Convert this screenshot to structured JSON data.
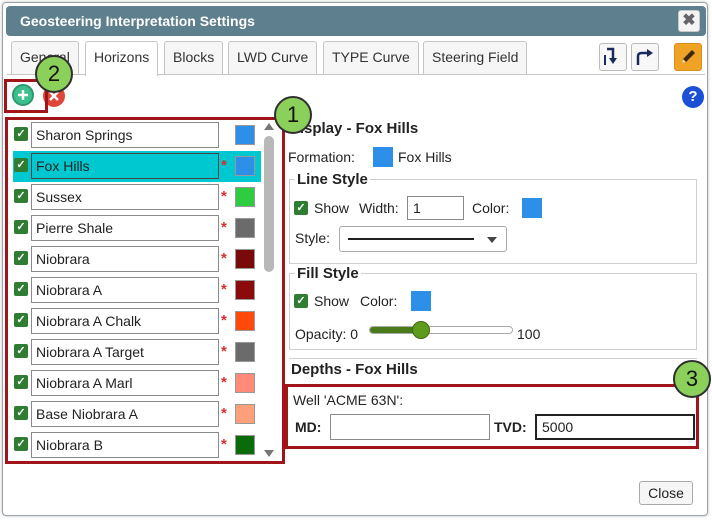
{
  "window": {
    "title": "Geosteering Interpretation Settings",
    "close_symbol": "✖"
  },
  "tabs": [
    {
      "label": "General"
    },
    {
      "label": "Horizons"
    },
    {
      "label": "Blocks"
    },
    {
      "label": "LWD Curve"
    },
    {
      "label": "TYPE Curve"
    },
    {
      "label": "Steering Field"
    }
  ],
  "active_tab": "Horizons",
  "callouts": {
    "one": "1",
    "two": "2",
    "three": "3"
  },
  "help_symbol": "?",
  "horizons": [
    {
      "name": "Sharon Springs",
      "required": false,
      "color": "#2e8fe8"
    },
    {
      "name": "Fox Hills",
      "required": true,
      "color": "#2e8fe8"
    },
    {
      "name": "Sussex",
      "required": true,
      "color": "#2ecc40"
    },
    {
      "name": "Pierre Shale",
      "required": true,
      "color": "#6b6b6b"
    },
    {
      "name": "Niobrara",
      "required": true,
      "color": "#7a0a0a"
    },
    {
      "name": "Niobrara A",
      "required": true,
      "color": "#8b0a0a"
    },
    {
      "name": "Niobrara A Chalk",
      "required": true,
      "color": "#ff4a0a"
    },
    {
      "name": "Niobrara A Target",
      "required": true,
      "color": "#6b6b6b"
    },
    {
      "name": "Niobrara A Marl",
      "required": true,
      "color": "#ff8a78"
    },
    {
      "name": "Base Niobrara A",
      "required": true,
      "color": "#ffa07a"
    },
    {
      "name": "Niobrara B",
      "required": true,
      "color": "#0a6b0a"
    }
  ],
  "required_marker": "*",
  "display": {
    "title": "Display - Fox Hills",
    "formation_label": "Formation:",
    "formation_value": "Fox Hills",
    "formation_color": "#2e8fe8",
    "line_style": {
      "title": "Line Style",
      "show_label": "Show",
      "width_label": "Width:",
      "width_value": "1",
      "color_label": "Color:",
      "color": "#2e8fe8",
      "style_label": "Style:"
    },
    "fill_style": {
      "title": "Fill Style",
      "show_label": "Show",
      "color_label": "Color:",
      "color": "#2e8fe8",
      "opacity_label": "Opacity: 0",
      "opacity_max_label": "100",
      "opacity_fraction": 0.36
    }
  },
  "depths": {
    "title": "Depths - Fox Hills",
    "well_label": "Well 'ACME 63N':",
    "md_label": "MD:",
    "md_value": "",
    "tvd_label": "TVD:",
    "tvd_value": "5000"
  },
  "footer": {
    "close_label": "Close"
  },
  "accent_colors": {
    "selection": "#00c8d0",
    "callout": "#8bd05a",
    "highlight_box": "#a0141a",
    "titlebar": "#5e7f8e"
  }
}
